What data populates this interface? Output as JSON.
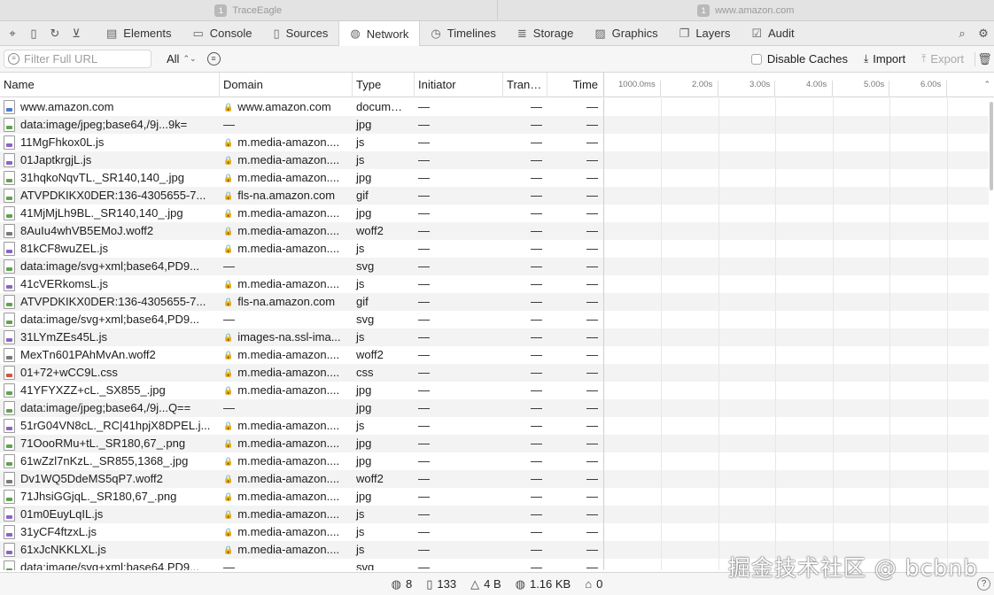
{
  "window_tabs": [
    {
      "badge": "1",
      "title": "TraceEagle"
    },
    {
      "badge": "1",
      "title": "www.amazon.com"
    }
  ],
  "toolbar": {
    "tabs": [
      {
        "icon": "elements-icon",
        "label": "Elements",
        "active": false
      },
      {
        "icon": "console-icon",
        "label": "Console",
        "active": false
      },
      {
        "icon": "sources-icon",
        "label": "Sources",
        "active": false
      },
      {
        "icon": "network-icon",
        "label": "Network",
        "active": true
      },
      {
        "icon": "timelines-icon",
        "label": "Timelines",
        "active": false
      },
      {
        "icon": "storage-icon",
        "label": "Storage",
        "active": false
      },
      {
        "icon": "graphics-icon",
        "label": "Graphics",
        "active": false
      },
      {
        "icon": "layers-icon",
        "label": "Layers",
        "active": false
      },
      {
        "icon": "audit-icon",
        "label": "Audit",
        "active": false
      }
    ]
  },
  "filterbar": {
    "url_placeholder": "Filter Full URL",
    "type_filter": "All",
    "disable_caches_label": "Disable Caches",
    "import_label": "Import",
    "export_label": "Export"
  },
  "table": {
    "headers": {
      "name": "Name",
      "domain": "Domain",
      "type": "Type",
      "initiator": "Initiator",
      "transfer": "Tran…",
      "time": "Time"
    },
    "timeline_ticks": [
      "1000.0ms",
      "2.00s",
      "3.00s",
      "4.00s",
      "5.00s",
      "6.00s"
    ],
    "rows": [
      {
        "name": "www.amazon.com",
        "icon": "doc",
        "lock": true,
        "domain": "www.amazon.com",
        "type": "docum…",
        "initiator": "—",
        "transfer": "—",
        "time": "—"
      },
      {
        "name": "data:image/jpeg;base64,/9j...9k=",
        "icon": "img",
        "lock": false,
        "domain": "—",
        "type": "jpg",
        "initiator": "—",
        "transfer": "—",
        "time": "—"
      },
      {
        "name": "11MgFhkox0L.js",
        "icon": "js",
        "lock": true,
        "domain": "m.media-amazon....",
        "type": "js",
        "initiator": "—",
        "transfer": "—",
        "time": "—"
      },
      {
        "name": "01JaptkrgjL.js",
        "icon": "js",
        "lock": true,
        "domain": "m.media-amazon....",
        "type": "js",
        "initiator": "—",
        "transfer": "—",
        "time": "—"
      },
      {
        "name": "31hqkoNqvTL._SR140,140_.jpg",
        "icon": "img",
        "lock": true,
        "domain": "m.media-amazon....",
        "type": "jpg",
        "initiator": "—",
        "transfer": "—",
        "time": "—"
      },
      {
        "name": "ATVPDKIKX0DER:136-4305655-7...",
        "icon": "img",
        "lock": true,
        "domain": "fls-na.amazon.com",
        "type": "gif",
        "initiator": "—",
        "transfer": "—",
        "time": "—"
      },
      {
        "name": "41MjMjLh9BL._SR140,140_.jpg",
        "icon": "img",
        "lock": true,
        "domain": "m.media-amazon....",
        "type": "jpg",
        "initiator": "—",
        "transfer": "—",
        "time": "—"
      },
      {
        "name": "8AuIu4whVB5EMoJ.woff2",
        "icon": "font",
        "lock": true,
        "domain": "m.media-amazon....",
        "type": "woff2",
        "initiator": "—",
        "transfer": "—",
        "time": "—"
      },
      {
        "name": "81kCF8wuZEL.js",
        "icon": "js",
        "lock": true,
        "domain": "m.media-amazon....",
        "type": "js",
        "initiator": "—",
        "transfer": "—",
        "time": "—"
      },
      {
        "name": "data:image/svg+xml;base64,PD9...",
        "icon": "img",
        "lock": false,
        "domain": "—",
        "type": "svg",
        "initiator": "—",
        "transfer": "—",
        "time": "—"
      },
      {
        "name": "41cVERkomsL.js",
        "icon": "js",
        "lock": true,
        "domain": "m.media-amazon....",
        "type": "js",
        "initiator": "—",
        "transfer": "—",
        "time": "—"
      },
      {
        "name": "ATVPDKIKX0DER:136-4305655-7...",
        "icon": "img",
        "lock": true,
        "domain": "fls-na.amazon.com",
        "type": "gif",
        "initiator": "—",
        "transfer": "—",
        "time": "—"
      },
      {
        "name": "data:image/svg+xml;base64,PD9...",
        "icon": "img",
        "lock": false,
        "domain": "—",
        "type": "svg",
        "initiator": "—",
        "transfer": "—",
        "time": "—"
      },
      {
        "name": "31LYmZEs45L.js",
        "icon": "js",
        "lock": true,
        "domain": "images-na.ssl-ima...",
        "type": "js",
        "initiator": "—",
        "transfer": "—",
        "time": "—"
      },
      {
        "name": "MexTn601PAhMvAn.woff2",
        "icon": "font",
        "lock": true,
        "domain": "m.media-amazon....",
        "type": "woff2",
        "initiator": "—",
        "transfer": "—",
        "time": "—"
      },
      {
        "name": "01+72+wCC9L.css",
        "icon": "css",
        "lock": true,
        "domain": "m.media-amazon....",
        "type": "css",
        "initiator": "—",
        "transfer": "—",
        "time": "—"
      },
      {
        "name": "41YFYXZZ+cL._SX855_.jpg",
        "icon": "img",
        "lock": true,
        "domain": "m.media-amazon....",
        "type": "jpg",
        "initiator": "—",
        "transfer": "—",
        "time": "—"
      },
      {
        "name": "data:image/jpeg;base64,/9j...Q==",
        "icon": "img",
        "lock": false,
        "domain": "—",
        "type": "jpg",
        "initiator": "—",
        "transfer": "—",
        "time": "—"
      },
      {
        "name": "51rG04VN8cL._RC|41hpjX8DPEL.j...",
        "icon": "js",
        "lock": true,
        "domain": "m.media-amazon....",
        "type": "js",
        "initiator": "—",
        "transfer": "—",
        "time": "—"
      },
      {
        "name": "71OooRMu+tL._SR180,67_.png",
        "icon": "img",
        "lock": true,
        "domain": "m.media-amazon....",
        "type": "jpg",
        "initiator": "—",
        "transfer": "—",
        "time": "—"
      },
      {
        "name": "61wZzl7nKzL._SR855,1368_.jpg",
        "icon": "img",
        "lock": true,
        "domain": "m.media-amazon....",
        "type": "jpg",
        "initiator": "—",
        "transfer": "—",
        "time": "—"
      },
      {
        "name": "Dv1WQ5DdeMS5qP7.woff2",
        "icon": "font",
        "lock": true,
        "domain": "m.media-amazon....",
        "type": "woff2",
        "initiator": "—",
        "transfer": "—",
        "time": "—"
      },
      {
        "name": "71JhsiGGjqL._SR180,67_.png",
        "icon": "img",
        "lock": true,
        "domain": "m.media-amazon....",
        "type": "jpg",
        "initiator": "—",
        "transfer": "—",
        "time": "—"
      },
      {
        "name": "01m0EuyLqIL.js",
        "icon": "js",
        "lock": true,
        "domain": "m.media-amazon....",
        "type": "js",
        "initiator": "—",
        "transfer": "—",
        "time": "—"
      },
      {
        "name": "31yCF4ftzxL.js",
        "icon": "js",
        "lock": true,
        "domain": "m.media-amazon....",
        "type": "js",
        "initiator": "—",
        "transfer": "—",
        "time": "—"
      },
      {
        "name": "61xJcNKKLXL.js",
        "icon": "js",
        "lock": true,
        "domain": "m.media-amazon....",
        "type": "js",
        "initiator": "—",
        "transfer": "—",
        "time": "—"
      },
      {
        "name": "data:image/svg+xml;base64,PD9...",
        "icon": "img",
        "lock": false,
        "domain": "—",
        "type": "svg",
        "initiator": "—",
        "transfer": "—",
        "time": "—"
      }
    ]
  },
  "statusbar": {
    "domains": "8",
    "resources": "133",
    "transferred": "4 B",
    "size": "1.16 KB",
    "load_time": "0"
  },
  "watermark": "掘金技术社区 @ bcbnb"
}
